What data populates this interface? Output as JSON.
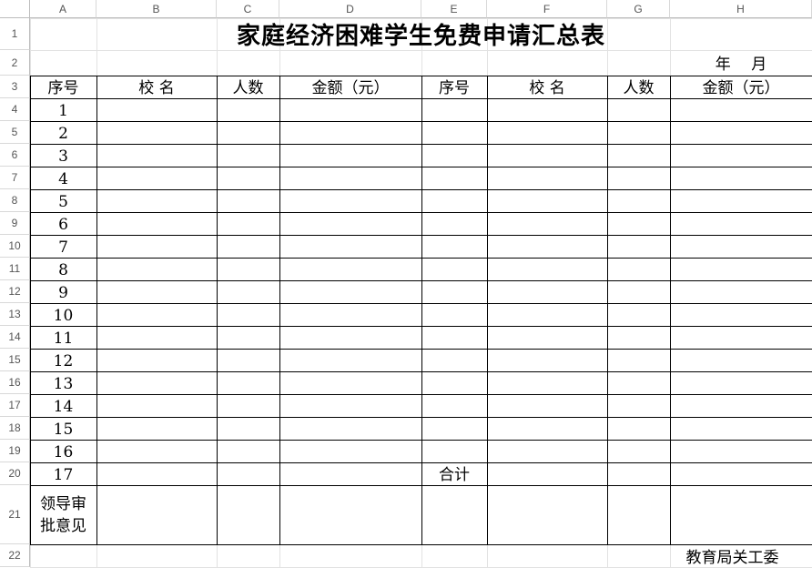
{
  "app": {
    "name": "spreadsheet"
  },
  "column_headers": [
    "A",
    "B",
    "C",
    "D",
    "E",
    "F",
    "G",
    "H"
  ],
  "row_headers": [
    "1",
    "2",
    "3",
    "4",
    "5",
    "6",
    "7",
    "8",
    "9",
    "10",
    "11",
    "12",
    "13",
    "14",
    "15",
    "16",
    "17",
    "18",
    "19",
    "20",
    "21",
    "22"
  ],
  "sheet": {
    "title": "家庭经济困难学生免费申请汇总表",
    "date_label": "年　 月",
    "headers": {
      "seq": "序号",
      "school": "校 名",
      "count": "人数",
      "amount": "金额（元）"
    },
    "row_numbers": [
      "1",
      "2",
      "3",
      "4",
      "5",
      "6",
      "7",
      "8",
      "9",
      "10",
      "11",
      "12",
      "13",
      "14",
      "15",
      "16",
      "17"
    ],
    "total_label": "合计",
    "approval_label": [
      "领导审",
      "批意见"
    ],
    "footer": "教育局关工委"
  }
}
